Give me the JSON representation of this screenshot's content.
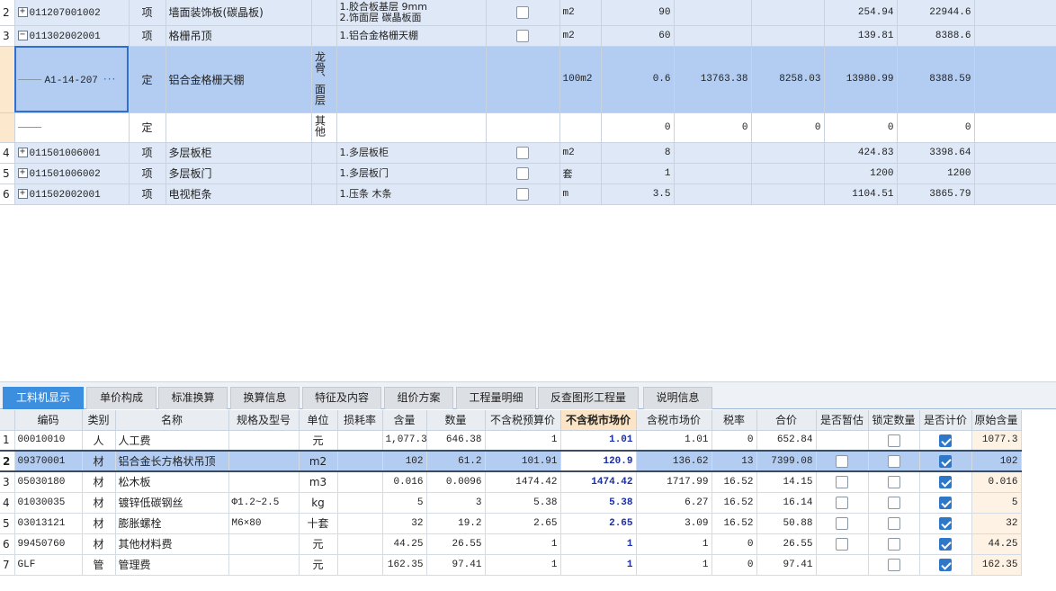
{
  "top_rows": [
    {
      "row": "2",
      "code": "011207001002",
      "type": "项",
      "name": "墙面装饰板(碳晶板)",
      "unit_col": "",
      "desc": "1.胶合板基层 9mm\n2.饰面层 碳晶板面",
      "unit": "m2",
      "qty": "90",
      "c1": "",
      "c2": "",
      "c3": "254.94",
      "c4": "22944.6",
      "expand": "+"
    },
    {
      "row": "3",
      "code": "011302002001",
      "type": "项",
      "name": "格栅吊顶",
      "unit_col": "",
      "desc": "1.铝合金格栅天棚",
      "unit": "m2",
      "qty": "60",
      "c1": "",
      "c2": "",
      "c3": "139.81",
      "c4": "8388.6",
      "expand": "−"
    },
    {
      "row": "",
      "code": "A1-14-207",
      "type": "定",
      "name": "铝合金格栅天棚",
      "unit_col": "龙骨、面层",
      "desc": "",
      "unit": "100m2",
      "qty": "0.6",
      "c1": "13763.38",
      "c2": "8258.03",
      "c3": "13980.99",
      "c4": "8388.59"
    },
    {
      "row": "",
      "code": "",
      "type": "定",
      "name": "",
      "unit_col": "其他",
      "desc": "",
      "unit": "",
      "qty": "0",
      "c1": "0",
      "c2": "0",
      "c3": "0",
      "c4": "0"
    },
    {
      "row": "4",
      "code": "011501006001",
      "type": "项",
      "name": "多层板柜",
      "unit_col": "",
      "desc": "1.多层板柜",
      "unit": "m2",
      "qty": "8",
      "c1": "",
      "c2": "",
      "c3": "424.83",
      "c4": "3398.64",
      "expand": "+"
    },
    {
      "row": "5",
      "code": "011501006002",
      "type": "项",
      "name": "多层板门",
      "unit_col": "",
      "desc": "1.多层板门",
      "unit": "套",
      "qty": "1",
      "c1": "",
      "c2": "",
      "c3": "1200",
      "c4": "1200",
      "expand": "+"
    },
    {
      "row": "6",
      "code": "011502002001",
      "type": "项",
      "name": "电视柜条",
      "unit_col": "",
      "desc": "1.压条 木条",
      "unit": "m",
      "qty": "3.5",
      "c1": "",
      "c2": "",
      "c3": "1104.51",
      "c4": "3865.79",
      "expand": "+"
    }
  ],
  "tabs": [
    "工料机显示",
    "单价构成",
    "标准换算",
    "换算信息",
    "特征及内容",
    "组价方案",
    "工程量明细",
    "反查图形工程量",
    "说明信息"
  ],
  "active_tab": 0,
  "headers": [
    "编码",
    "类别",
    "名称",
    "规格及型号",
    "单位",
    "损耗率",
    "含量",
    "数量",
    "不含税预算价",
    "不含税市场价",
    "含税市场价",
    "税率",
    "合价",
    "是否暂估",
    "锁定数量",
    "是否计价",
    "原始含量"
  ],
  "rows": [
    {
      "n": "1",
      "code": "00010010",
      "cat": "人",
      "name": "人工费",
      "spec": "",
      "unit": "元",
      "loss": "",
      "content": "1,077.3",
      "qty": "646.38",
      "budget": "1",
      "market": "1.01",
      "tax_market": "1.01",
      "rate": "0",
      "total": "652.84",
      "est": null,
      "lock": false,
      "price": true,
      "orig": "1077.3"
    },
    {
      "n": "2",
      "code": "09370001",
      "cat": "材",
      "name": "铝合金长方格状吊顶",
      "spec": "",
      "unit": "m2",
      "loss": "",
      "content": "102",
      "qty": "61.2",
      "budget": "101.91",
      "market": "120.9",
      "tax_market": "136.62",
      "rate": "13",
      "total": "7399.08",
      "est": false,
      "lock": false,
      "price": true,
      "orig": "102"
    },
    {
      "n": "3",
      "code": "05030180",
      "cat": "材",
      "name": "松木板",
      "spec": "",
      "unit": "m3",
      "loss": "",
      "content": "0.016",
      "qty": "0.0096",
      "budget": "1474.42",
      "market": "1474.42",
      "tax_market": "1717.99",
      "rate": "16.52",
      "total": "14.15",
      "est": false,
      "lock": false,
      "price": true,
      "orig": "0.016"
    },
    {
      "n": "4",
      "code": "01030035",
      "cat": "材",
      "name": "镀锌低碳钢丝",
      "spec": "Φ1.2~2.5",
      "unit": "kg",
      "loss": "",
      "content": "5",
      "qty": "3",
      "budget": "5.38",
      "market": "5.38",
      "tax_market": "6.27",
      "rate": "16.52",
      "total": "16.14",
      "est": false,
      "lock": false,
      "price": true,
      "orig": "5"
    },
    {
      "n": "5",
      "code": "03013121",
      "cat": "材",
      "name": "膨胀螺栓",
      "spec": "M6×80",
      "unit": "十套",
      "loss": "",
      "content": "32",
      "qty": "19.2",
      "budget": "2.65",
      "market": "2.65",
      "tax_market": "3.09",
      "rate": "16.52",
      "total": "50.88",
      "est": false,
      "lock": false,
      "price": true,
      "orig": "32"
    },
    {
      "n": "6",
      "code": "99450760",
      "cat": "材",
      "name": "其他材料费",
      "spec": "",
      "unit": "元",
      "loss": "",
      "content": "44.25",
      "qty": "26.55",
      "budget": "1",
      "market": "1",
      "tax_market": "1",
      "rate": "0",
      "total": "26.55",
      "est": false,
      "lock": false,
      "price": true,
      "orig": "44.25"
    },
    {
      "n": "7",
      "code": "GLF",
      "cat": "管",
      "name": "管理费",
      "spec": "",
      "unit": "元",
      "loss": "",
      "content": "162.35",
      "qty": "97.41",
      "budget": "1",
      "market": "1",
      "tax_market": "1",
      "rate": "0",
      "total": "97.41",
      "est": null,
      "lock": false,
      "price": true,
      "orig": "162.35"
    }
  ]
}
